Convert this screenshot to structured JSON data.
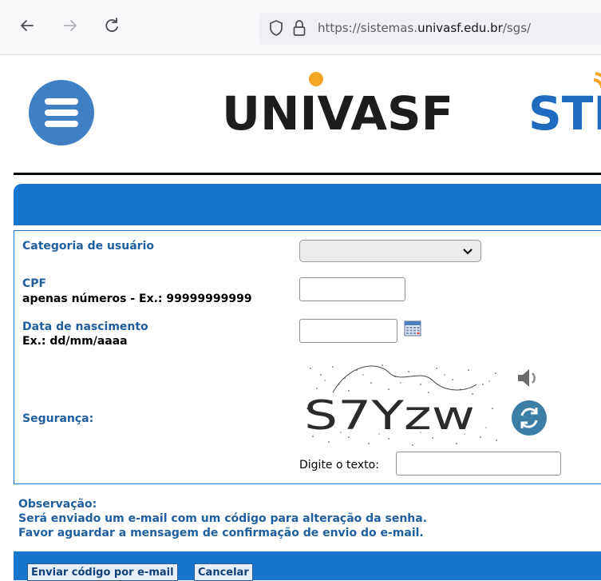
{
  "browser": {
    "url_prefix": "https://sistemas.",
    "url_host": "univasf.edu.br",
    "url_suffix": "/sgs/"
  },
  "header": {
    "logo_text": "UNIVASF",
    "logo_sti": "STI"
  },
  "form": {
    "categoria_label": "Categoria de usuário",
    "categoria_value": "",
    "cpf_label": "CPF",
    "cpf_hint": "apenas números - Ex.: 99999999999",
    "cpf_value": "",
    "nascimento_label": "Data de nascimento",
    "nascimento_hint": "Ex.: dd/mm/aaaa",
    "nascimento_value": "",
    "seguranca_label": "Segurança:",
    "captcha_text": "S7Yzw",
    "digite_label": "Digite o texto:",
    "digite_value": ""
  },
  "observacao": {
    "title": "Observação:",
    "line1": "Será enviado um e-mail com um código para alteração da senha.",
    "line2": "Favor aguardar a mensagem de confirmação de envio do e-mail."
  },
  "buttons": {
    "enviar": "Enviar código por e-mail",
    "cancelar": "Cancelar"
  },
  "colors": {
    "brand_blue": "#1775cf",
    "label_blue": "#1f5fa0",
    "logo_orange": "#f5a623"
  }
}
